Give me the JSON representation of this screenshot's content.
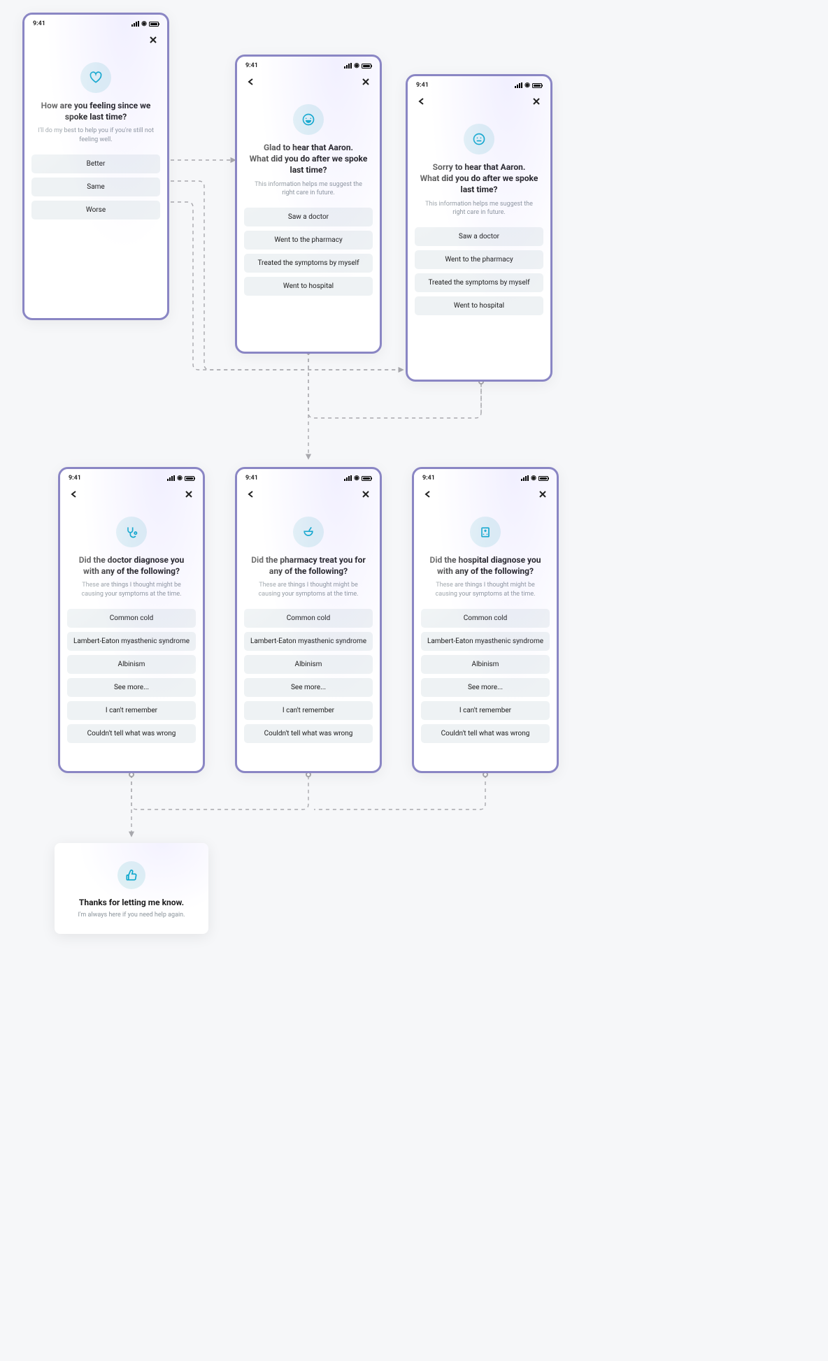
{
  "status_time": "9:41",
  "screens": {
    "s1": {
      "has_back": false,
      "icon": "heart",
      "question": "How are you feeling since we spoke last time?",
      "subtitle": "I'll do my best to help you if you're still not feeling well.",
      "options": [
        "Better",
        "Same",
        "Worse"
      ]
    },
    "s2": {
      "has_back": true,
      "icon": "happy",
      "question": "Glad to hear that Aaron.\nWhat did you do after we spoke last time?",
      "subtitle": "This information helps me suggest the right care in future.",
      "options": [
        "Saw a doctor",
        "Went to the pharmacy",
        "Treated the symptoms by myself",
        "Went to hospital"
      ]
    },
    "s3": {
      "has_back": true,
      "icon": "neutral",
      "question": "Sorry to hear that Aaron.\nWhat did you do after we spoke last time?",
      "subtitle": "This information helps me suggest the right care in future.",
      "options": [
        "Saw a doctor",
        "Went to the pharmacy",
        "Treated the symptoms by myself",
        "Went to hospital"
      ]
    },
    "s4": {
      "has_back": true,
      "icon": "stethoscope",
      "question": "Did the doctor diagnose you with any of the following?",
      "subtitle": "These are things I thought might be causing your symptoms at the time.",
      "options": [
        "Common cold",
        "Lambert-Eaton myasthenic syndrome",
        "Albinism",
        "See more...",
        "I can't remember",
        "Couldn't tell what was wrong"
      ]
    },
    "s5": {
      "has_back": true,
      "icon": "mortar",
      "question": "Did the pharmacy treat you for any of the following?",
      "subtitle": "These are things I thought might be causing your symptoms at the time.",
      "options": [
        "Common cold",
        "Lambert-Eaton myasthenic syndrome",
        "Albinism",
        "See more...",
        "I can't remember",
        "Couldn't tell what was wrong"
      ]
    },
    "s6": {
      "has_back": true,
      "icon": "hospital",
      "question": "Did the hospital diagnose you with any of the following?",
      "subtitle": "These are things I thought might be causing your symptoms at the time.",
      "options": [
        "Common cold",
        "Lambert-Eaton myasthenic syndrome",
        "Albinism",
        "See more...",
        "I can't remember",
        "Couldn't tell what was wrong"
      ]
    }
  },
  "callout": {
    "icon": "thumbs-up",
    "title": "Thanks for letting me know.",
    "subtitle": "I'm always here if you need help again."
  }
}
